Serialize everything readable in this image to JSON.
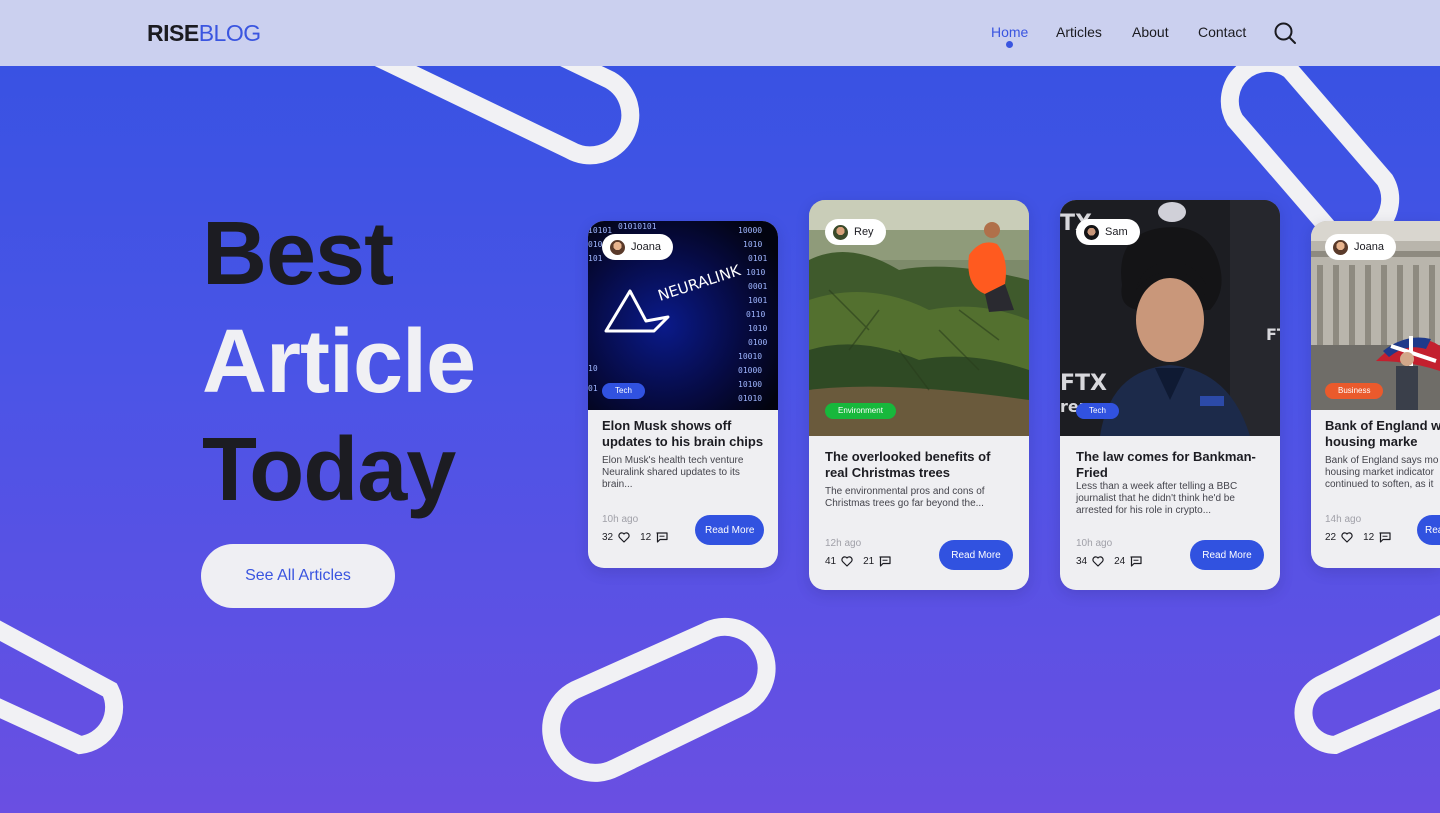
{
  "brand": {
    "part1": "RISE",
    "part2": "BLOG"
  },
  "nav": {
    "items": [
      {
        "label": "Home",
        "active": true
      },
      {
        "label": "Articles"
      },
      {
        "label": "About"
      },
      {
        "label": "Contact"
      }
    ],
    "search_icon": "search-icon"
  },
  "hero": {
    "line1": "Best",
    "line2": "Article",
    "line3": "Today",
    "cta_label": "See All Articles"
  },
  "cards": [
    {
      "author": "Joana",
      "tag": "Tech",
      "tag_color": "#3152e0",
      "title": "Elon Musk shows off updates to his brain chips",
      "excerpt": "Elon Musk's health tech venture Neuralink shared updates to its brain...",
      "time": "10h ago",
      "likes": "32",
      "comments": "12",
      "read_more": "Read More",
      "image_text": "NEURALINK"
    },
    {
      "author": "Rey",
      "tag": "Environment",
      "tag_color": "#17b83c",
      "title": "The overlooked benefits of real Christmas trees",
      "excerpt": "The environmental pros and cons of Christmas trees go far beyond the...",
      "time": "12h ago",
      "likes": "41",
      "comments": "21",
      "read_more": "Read More"
    },
    {
      "author": "Sam",
      "tag": "Tech",
      "tag_color": "#3152e0",
      "title": "The law comes for Bankman-Fried",
      "excerpt": "Less than a week after telling a BBC journalist that he didn't think he'd be arrested for his role in crypto...",
      "time": "10h ago",
      "likes": "34",
      "comments": "24",
      "read_more": "Read More"
    },
    {
      "author": "Joana",
      "tag": "Business",
      "tag_color": "#ea5a2c",
      "title": "Bank of England w UK housing marke",
      "excerpt": "Bank of England says mo housing market indicator continued to soften, as it",
      "time": "14h ago",
      "likes": "22",
      "comments": "12",
      "read_more": "Rea"
    }
  ],
  "colors": {
    "accent": "#3a55e0",
    "navbar_bg": "#cbd0ef",
    "hero_gradient_top": "#3552e2",
    "hero_gradient_bottom": "#6a4fe2",
    "card_bg": "#efeff2"
  }
}
